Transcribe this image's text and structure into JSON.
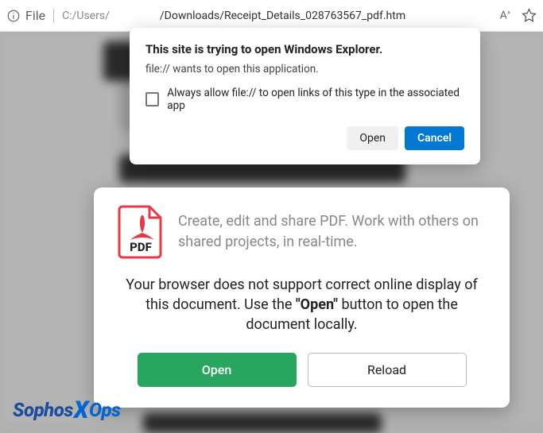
{
  "address_bar": {
    "file_label": "File",
    "path_prefix": "C:/Users/",
    "path_suffix": "/Downloads/Receipt_Details_028763567_pdf.htm",
    "read_aloud_label": "A",
    "read_aloud_sup": "»"
  },
  "system_dialog": {
    "title": "This site is trying to open Windows Explorer.",
    "message": "file:// wants to open this application.",
    "checkbox_label": "Always allow file:// to open links of this type in the associated app",
    "open_label": "Open",
    "cancel_label": "Cancel"
  },
  "page_dialog": {
    "pdf_badge": "PDF",
    "subtitle": "Create, edit and share PDF. Work with others on shared projects, in real-time.",
    "message_pre": "Your browser does not support correct online display of this document. Use the ",
    "message_bold": "\"Open\"",
    "message_post": " button to open the document locally.",
    "open_label": "Open",
    "reload_label": "Reload"
  },
  "watermark": {
    "left": "Sophos",
    "mid": "X",
    "right": "Ops"
  }
}
